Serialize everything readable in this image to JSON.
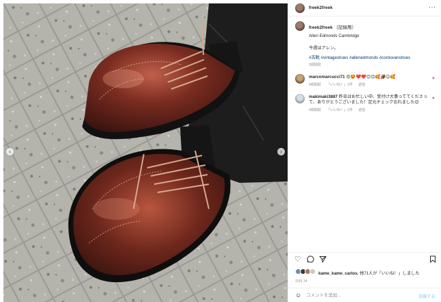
{
  "post": {
    "username": "freek2freek",
    "more_label": "···",
    "caption": {
      "username": "freek2freek",
      "note": "（記録用）",
      "line1": "Allen Edmonds Cambridge",
      "line2": "今週はアレン。",
      "hashtags": "#古靴 #vintageshoes #allenedmonds #cordovanshoes",
      "time": "9週間前"
    }
  },
  "comments": [
    {
      "username": "marcomarcucci71",
      "text": "😍🤩❤️❤️😊😊🥰🏈😉🥰",
      "time": "9週間前",
      "likes": "「いいね！」1件",
      "reply": "返信"
    },
    {
      "username": "makimaki3887",
      "text": "昨日はお忙しい中、受付け大事っててくださって、ありがとうございました！足元チェック忘れました😊",
      "time": "9週間前",
      "likes": "「いいね！」1件",
      "reply": "返信"
    }
  ],
  "actions": {
    "like_icon": "heart-icon",
    "comment_icon": "comment-icon",
    "share_icon": "share-icon",
    "save_icon": "bookmark-icon"
  },
  "likes": {
    "user": "kame_kame_carlos.",
    "text": "他71人が「いいね！」しました"
  },
  "date": "10月 24",
  "add_comment": {
    "placeholder": "コメントを追加...",
    "post_label": "投稿する"
  },
  "nav": {
    "prev": "‹",
    "next": "›"
  }
}
